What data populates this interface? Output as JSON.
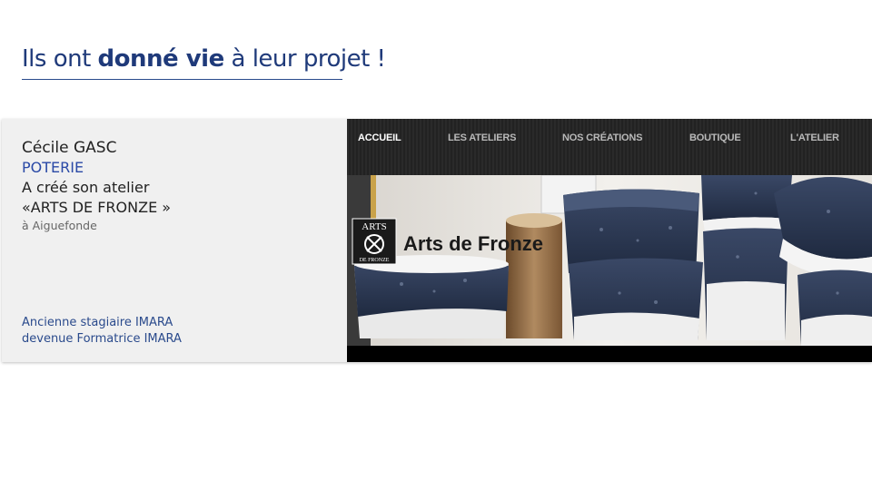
{
  "heading": {
    "prefix": "Ils ont ",
    "emphasis": "donné vie",
    "suffix": " à leur projet !"
  },
  "profile": {
    "name": "Cécile GASC",
    "craft": "POTERIE",
    "line1": "A créé son atelier",
    "line2": "«ARTS DE FRONZE »",
    "location": "à Aiguefonde",
    "history_line1": "Ancienne stagiaire IMARA",
    "history_line2": "devenue Formatrice IMARA"
  },
  "website": {
    "nav": [
      "ACCUEIL",
      "LES ATELIERS",
      "NOS CRÉATIONS",
      "BOUTIQUE",
      "L'ATELIER"
    ],
    "logo_top": "ARTS",
    "logo_bottom": "DE FRONZE",
    "brand": "Arts de Fronze"
  },
  "colors": {
    "heading": "#1f3a7a",
    "craft": "#2a49a6",
    "glaze": "#2c3a55"
  }
}
